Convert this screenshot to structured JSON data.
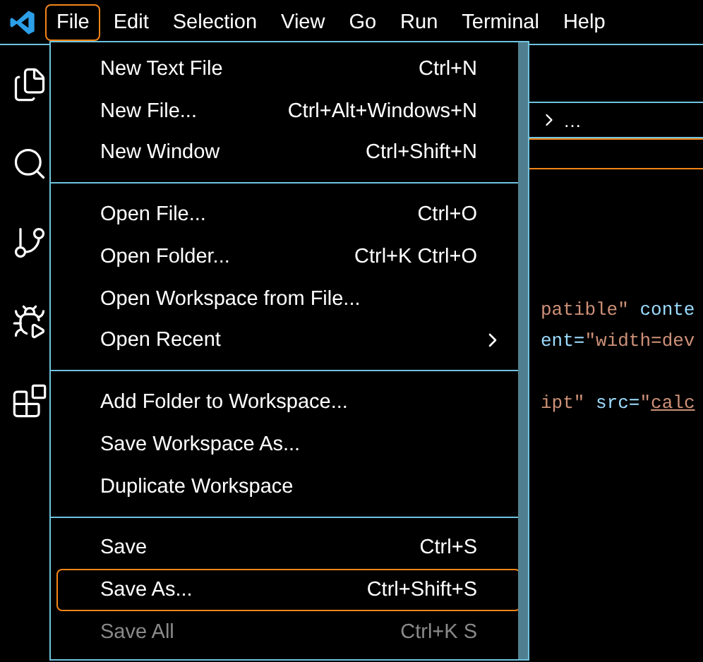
{
  "menubar": {
    "items": [
      {
        "label": "File",
        "selected": true
      },
      {
        "label": "Edit",
        "selected": false
      },
      {
        "label": "Selection",
        "selected": false
      },
      {
        "label": "View",
        "selected": false
      },
      {
        "label": "Go",
        "selected": false
      },
      {
        "label": "Run",
        "selected": false
      },
      {
        "label": "Terminal",
        "selected": false
      },
      {
        "label": "Help",
        "selected": false
      }
    ]
  },
  "breadcrumb": {
    "text": "…"
  },
  "editor": {
    "lines": [
      {
        "kind": "current"
      },
      {
        "kind": "blank"
      },
      {
        "kind": "blank"
      },
      {
        "kind": "blank"
      },
      {
        "kind": "blank"
      },
      {
        "kind": "code",
        "tokens": [
          {
            "kind": "value",
            "text": "patible\""
          },
          {
            "kind": "attr",
            "text": " conte"
          }
        ]
      },
      {
        "kind": "code",
        "tokens": [
          {
            "kind": "attr",
            "text": "ent="
          },
          {
            "kind": "value",
            "text": "\"width=dev"
          }
        ]
      },
      {
        "kind": "blank"
      },
      {
        "kind": "code",
        "tokens": [
          {
            "kind": "value",
            "text": "ipt\""
          },
          {
            "kind": "attr",
            "text": " src="
          },
          {
            "kind": "value",
            "text": "\""
          },
          {
            "kind": "link",
            "text": "calc"
          }
        ]
      }
    ]
  },
  "file_menu": {
    "groups": [
      {
        "items": [
          {
            "label": "New Text File",
            "shortcut": "Ctrl+N",
            "selected": false,
            "disabled": false
          },
          {
            "label": "New File...",
            "shortcut": "Ctrl+Alt+Windows+N",
            "selected": false,
            "disabled": false
          },
          {
            "label": "New Window",
            "shortcut": "Ctrl+Shift+N",
            "selected": false,
            "disabled": false
          }
        ]
      },
      {
        "items": [
          {
            "label": "Open File...",
            "shortcut": "Ctrl+O",
            "selected": false,
            "disabled": false
          },
          {
            "label": "Open Folder...",
            "shortcut": "Ctrl+K Ctrl+O",
            "selected": false,
            "disabled": false
          },
          {
            "label": "Open Workspace from File...",
            "selected": false,
            "disabled": false
          },
          {
            "label": "Open Recent",
            "submenu": true,
            "selected": false,
            "disabled": false
          }
        ]
      },
      {
        "items": [
          {
            "label": "Add Folder to Workspace...",
            "selected": false,
            "disabled": false
          },
          {
            "label": "Save Workspace As...",
            "selected": false,
            "disabled": false
          },
          {
            "label": "Duplicate Workspace",
            "selected": false,
            "disabled": false
          }
        ]
      },
      {
        "items": [
          {
            "label": "Save",
            "shortcut": "Ctrl+S",
            "selected": false,
            "disabled": false
          },
          {
            "label": "Save As...",
            "shortcut": "Ctrl+Shift+S",
            "selected": true,
            "disabled": false
          },
          {
            "label": "Save All",
            "shortcut": "Ctrl+K S",
            "selected": false,
            "disabled": true
          }
        ]
      }
    ]
  }
}
